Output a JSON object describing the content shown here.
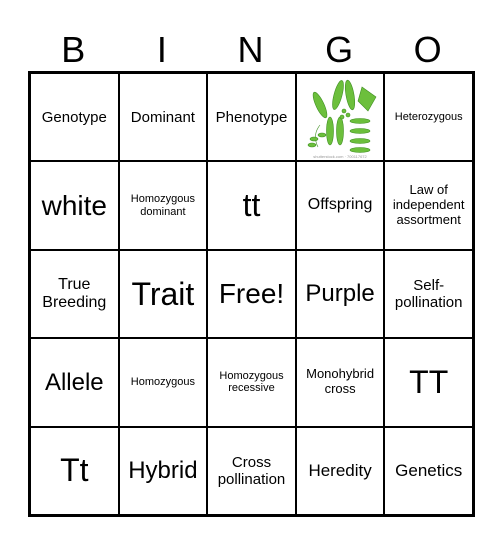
{
  "header": [
    "B",
    "I",
    "N",
    "G",
    "O"
  ],
  "cells": [
    {
      "text": "Genotype",
      "size": "s15"
    },
    {
      "text": "Dominant",
      "size": "s15"
    },
    {
      "text": "Phenotype",
      "size": "s15"
    },
    {
      "image": "pea-pods-image",
      "caption": "shutterstock.com · 700117672"
    },
    {
      "text": "Heterozygous",
      "size": "s11"
    },
    {
      "text": "white",
      "size": "s28"
    },
    {
      "text": "Homozygous dominant",
      "size": "s11"
    },
    {
      "text": "tt",
      "size": "s32"
    },
    {
      "text": "Offspring",
      "size": "s16"
    },
    {
      "text": "Law of independent assortment",
      "size": "s13"
    },
    {
      "text": "True Breeding",
      "size": "s16"
    },
    {
      "text": "Trait",
      "size": "s32"
    },
    {
      "text": "Free!",
      "size": "s28"
    },
    {
      "text": "Purple",
      "size": "s24"
    },
    {
      "text": "Self-pollination",
      "size": "s15"
    },
    {
      "text": "Allele",
      "size": "s24"
    },
    {
      "text": "Homozygous",
      "size": "s11"
    },
    {
      "text": "Homozygous recessive",
      "size": "s11"
    },
    {
      "text": "Monohybrid cross",
      "size": "s13"
    },
    {
      "text": "TT",
      "size": "s32"
    },
    {
      "text": "Tt",
      "size": "s32"
    },
    {
      "text": "Hybrid",
      "size": "s24"
    },
    {
      "text": "Cross pollination",
      "size": "s15"
    },
    {
      "text": "Heredity",
      "size": "s17"
    },
    {
      "text": "Genetics",
      "size": "s17"
    }
  ]
}
